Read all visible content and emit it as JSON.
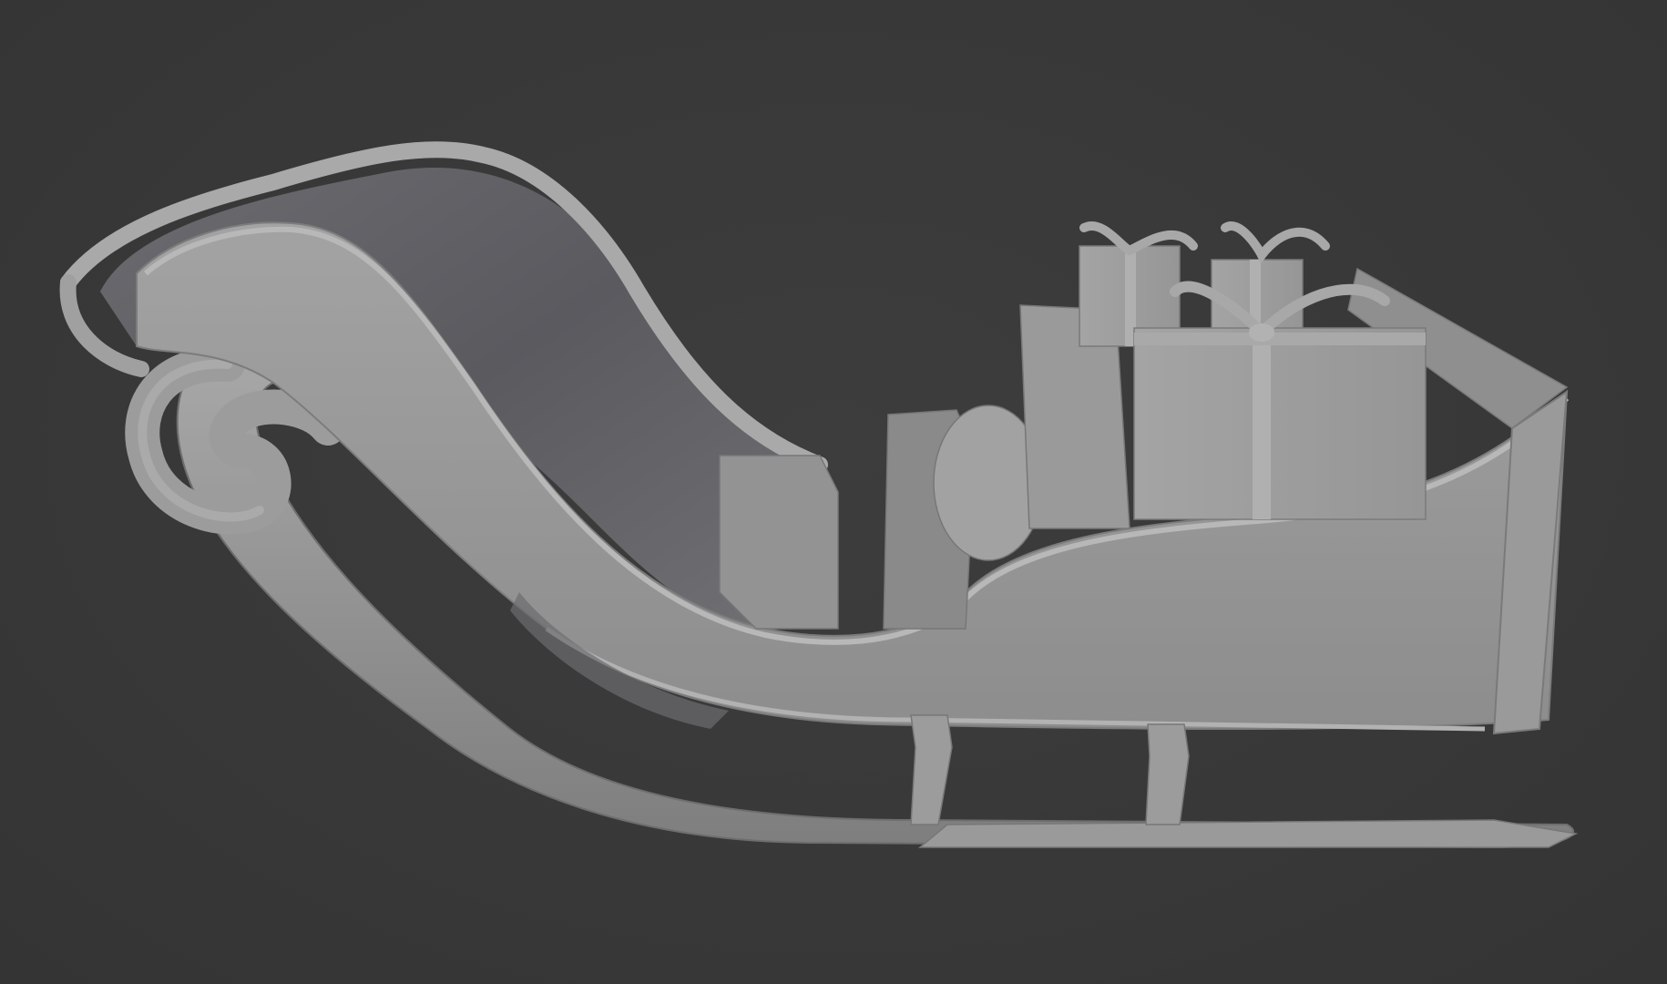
{
  "viewport": {
    "background": "#3a3a3a",
    "shading": "solid",
    "subject": "sleigh-with-gift-boxes"
  },
  "palette": {
    "clay_light": "#a6a6a6",
    "clay_mid": "#8f8f8f",
    "clay_dark": "#6a6a6a",
    "clay_shadow": "#55555a",
    "cushion_dark": "#5e5e63"
  }
}
